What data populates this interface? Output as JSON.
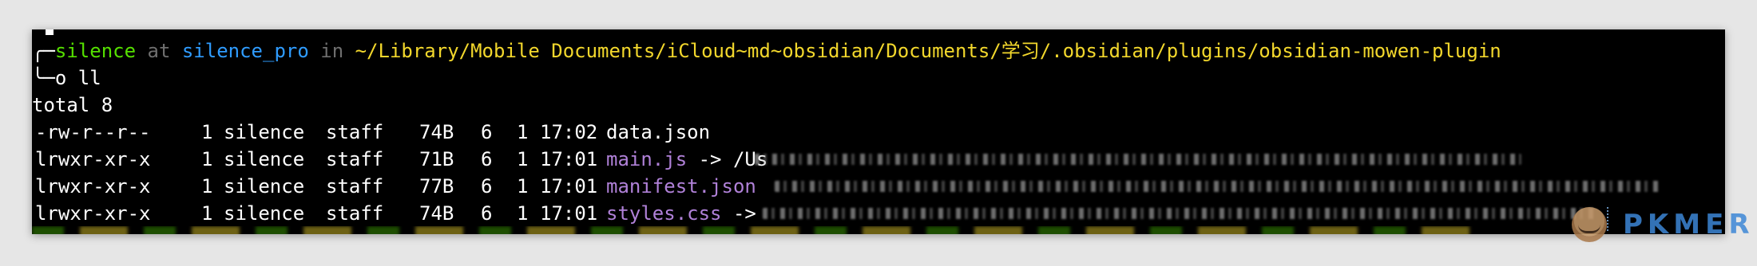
{
  "prompt": {
    "box_top": "╭─",
    "user": "silence",
    "at": " at ",
    "host": "silence_pro",
    "in": " in ",
    "path": "~/Library/Mobile Documents/iCloud~md~obsidian/Documents/学习/.obsidian/plugins/obsidian-mowen-plugin",
    "box_bottom": "╰─o ",
    "command": "ll"
  },
  "output": {
    "total": "total 8",
    "rows": [
      {
        "perm": "-rw-r--r--",
        "links": "1",
        "user": "silence",
        "group": "staff",
        "size": "74B",
        "month": "6",
        "day": "1",
        "time": "17:02",
        "name": "data.json",
        "suffix": ""
      },
      {
        "perm": "lrwxr-xr-x",
        "links": "1",
        "user": "silence",
        "group": "staff",
        "size": "71B",
        "month": "6",
        "day": "1",
        "time": "17:01",
        "name": "main.js",
        "suffix": " -> /Us"
      },
      {
        "perm": "lrwxr-xr-x",
        "links": "1",
        "user": "silence",
        "group": "staff",
        "size": "77B",
        "month": "6",
        "day": "1",
        "time": "17:01",
        "name": "manifest.json",
        "suffix": ""
      },
      {
        "perm": "lrwxr-xr-x",
        "links": "1",
        "user": "silence",
        "group": "staff",
        "size": "74B",
        "month": "6",
        "day": "1",
        "time": "17:01",
        "name": "styles.css",
        "suffix": " -> "
      }
    ]
  },
  "watermark": {
    "text": "PKMER"
  },
  "colors": {
    "user": "#55e000",
    "host": "#2f9cff",
    "path": "#f2d72c",
    "symlink": "#b081d8",
    "dim": "#6f6f6f",
    "background": "#000000"
  }
}
